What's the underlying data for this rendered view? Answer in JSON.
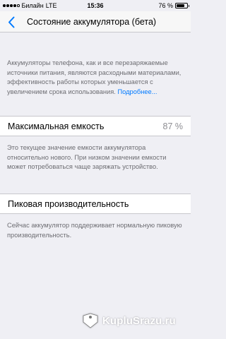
{
  "status_bar": {
    "carrier": "Билайн",
    "network": "LTE",
    "time": "15:36",
    "battery_percent": "76 %",
    "battery_level": 0.76,
    "signal_bars_filled": 4,
    "signal_bars_total": 5
  },
  "nav": {
    "back_icon": "chevron-left-icon",
    "title": "Состояние аккумулятора (бета)"
  },
  "intro": {
    "text": "Аккумуляторы телефона, как и все перезаряжаемые источники питания, являются расходными материалами, эффективность работы которых уменьшается с увеличением срока использования.",
    "link": "Подробнее..."
  },
  "max_capacity": {
    "label": "Максимальная емкость",
    "value": "87 %",
    "footer": "Это текущее значение емкости аккумулятора относительно нового. При низком значении емкости может потребоваться чаще заряжать устройство."
  },
  "peak_performance": {
    "label": "Пиковая производительность",
    "footer": "Сейчас аккумулятор поддерживает нормальную пиковую производительность."
  },
  "watermark": {
    "text": "KupluSrazu.ru",
    "icon": "tag-icon"
  },
  "colors": {
    "accent": "#007aff",
    "background": "#efeff4",
    "secondary_text": "#6d6d72"
  }
}
